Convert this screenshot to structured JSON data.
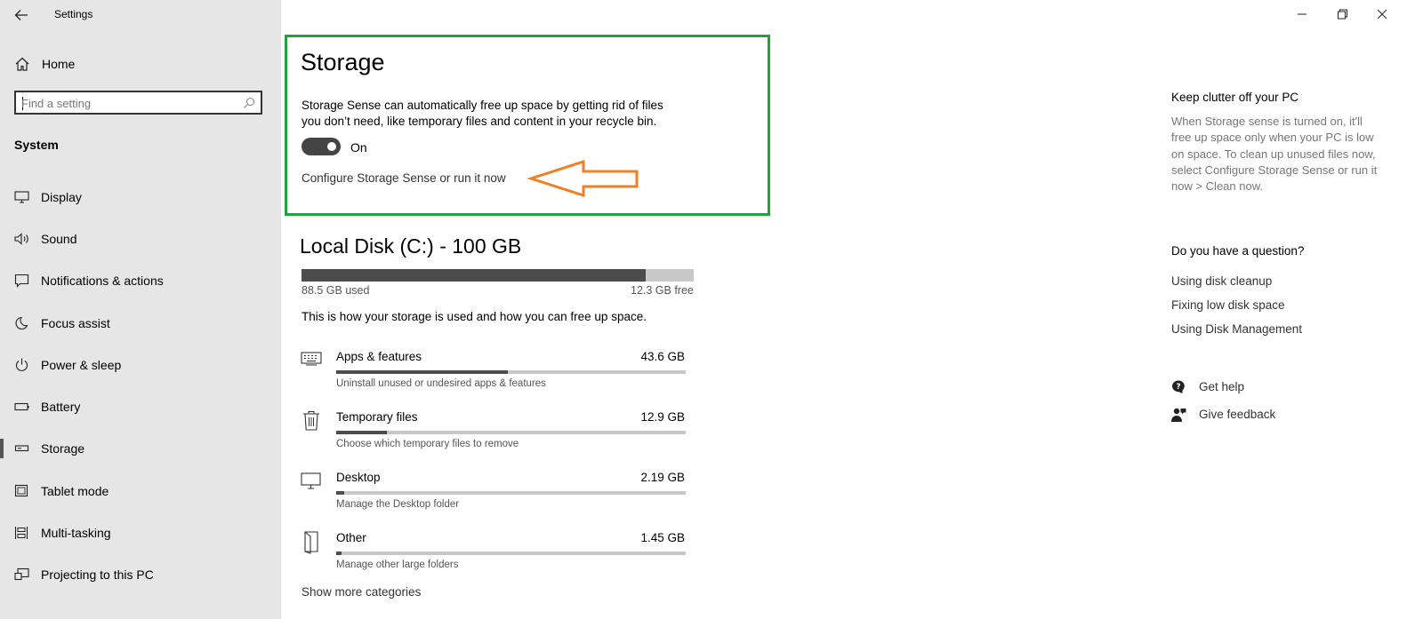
{
  "window": {
    "title": "Settings",
    "controls": {
      "minimize": "minimize-icon",
      "restore": "restore-icon",
      "close": "close-icon"
    }
  },
  "sidebar": {
    "home_label": "Home",
    "search_placeholder": "Find a setting",
    "section_title": "System",
    "items": [
      {
        "label": "Display",
        "icon": "monitor-icon"
      },
      {
        "label": "Sound",
        "icon": "speaker-icon"
      },
      {
        "label": "Notifications & actions",
        "icon": "notification-icon"
      },
      {
        "label": "Focus assist",
        "icon": "moon-icon"
      },
      {
        "label": "Power & sleep",
        "icon": "power-icon"
      },
      {
        "label": "Battery",
        "icon": "battery-icon"
      },
      {
        "label": "Storage",
        "icon": "storage-drive-icon",
        "active": true
      },
      {
        "label": "Tablet mode",
        "icon": "tablet-icon"
      },
      {
        "label": "Multi-tasking",
        "icon": "multitasking-icon"
      },
      {
        "label": "Projecting to this PC",
        "icon": "projecting-icon"
      }
    ]
  },
  "main": {
    "title": "Storage",
    "storage_sense": {
      "description": "Storage Sense can automatically free up space by getting rid of files you don’t need, like temporary files and content in your recycle bin.",
      "toggle_state": "On",
      "configure_link": "Configure Storage Sense or run it now"
    },
    "colors": {
      "highlight_border": "#22a33a",
      "arrow": "#f08024",
      "bar_fill": "#4c4c4c",
      "bar_track": "#c8c8c8"
    },
    "disk": {
      "title": "Local Disk (C:) - 100 GB",
      "used_label": "88.5 GB used",
      "free_label": "12.3 GB free",
      "used_fraction": 0.878
    },
    "usage_description": "This is how your storage is used and how you can free up space.",
    "categories": [
      {
        "name": "Apps & features",
        "size": "43.6 GB",
        "subtitle": "Uninstall unused or undesired apps & features",
        "fraction": 0.49,
        "icon": "keyboard-icon"
      },
      {
        "name": "Temporary files",
        "size": "12.9 GB",
        "subtitle": "Choose which temporary files to remove",
        "fraction": 0.145,
        "icon": "trash-icon"
      },
      {
        "name": "Desktop",
        "size": "2.19 GB",
        "subtitle": "Manage the Desktop folder",
        "fraction": 0.022,
        "icon": "desktop-icon"
      },
      {
        "name": "Other",
        "size": "1.45 GB",
        "subtitle": "Manage other large folders",
        "fraction": 0.015,
        "icon": "folder-icon"
      }
    ],
    "show_more": "Show more categories"
  },
  "right": {
    "tip_heading": "Keep clutter off your PC",
    "tip_text": "When Storage sense is turned on, it'll free up space only when your PC is low on space. To clean up unused files now, select Configure Storage Sense or run it now > Clean now.",
    "question_heading": "Do you have a question?",
    "links": [
      "Using disk cleanup",
      "Fixing low disk space",
      "Using Disk Management"
    ],
    "get_help": "Get help",
    "give_feedback": "Give feedback"
  }
}
